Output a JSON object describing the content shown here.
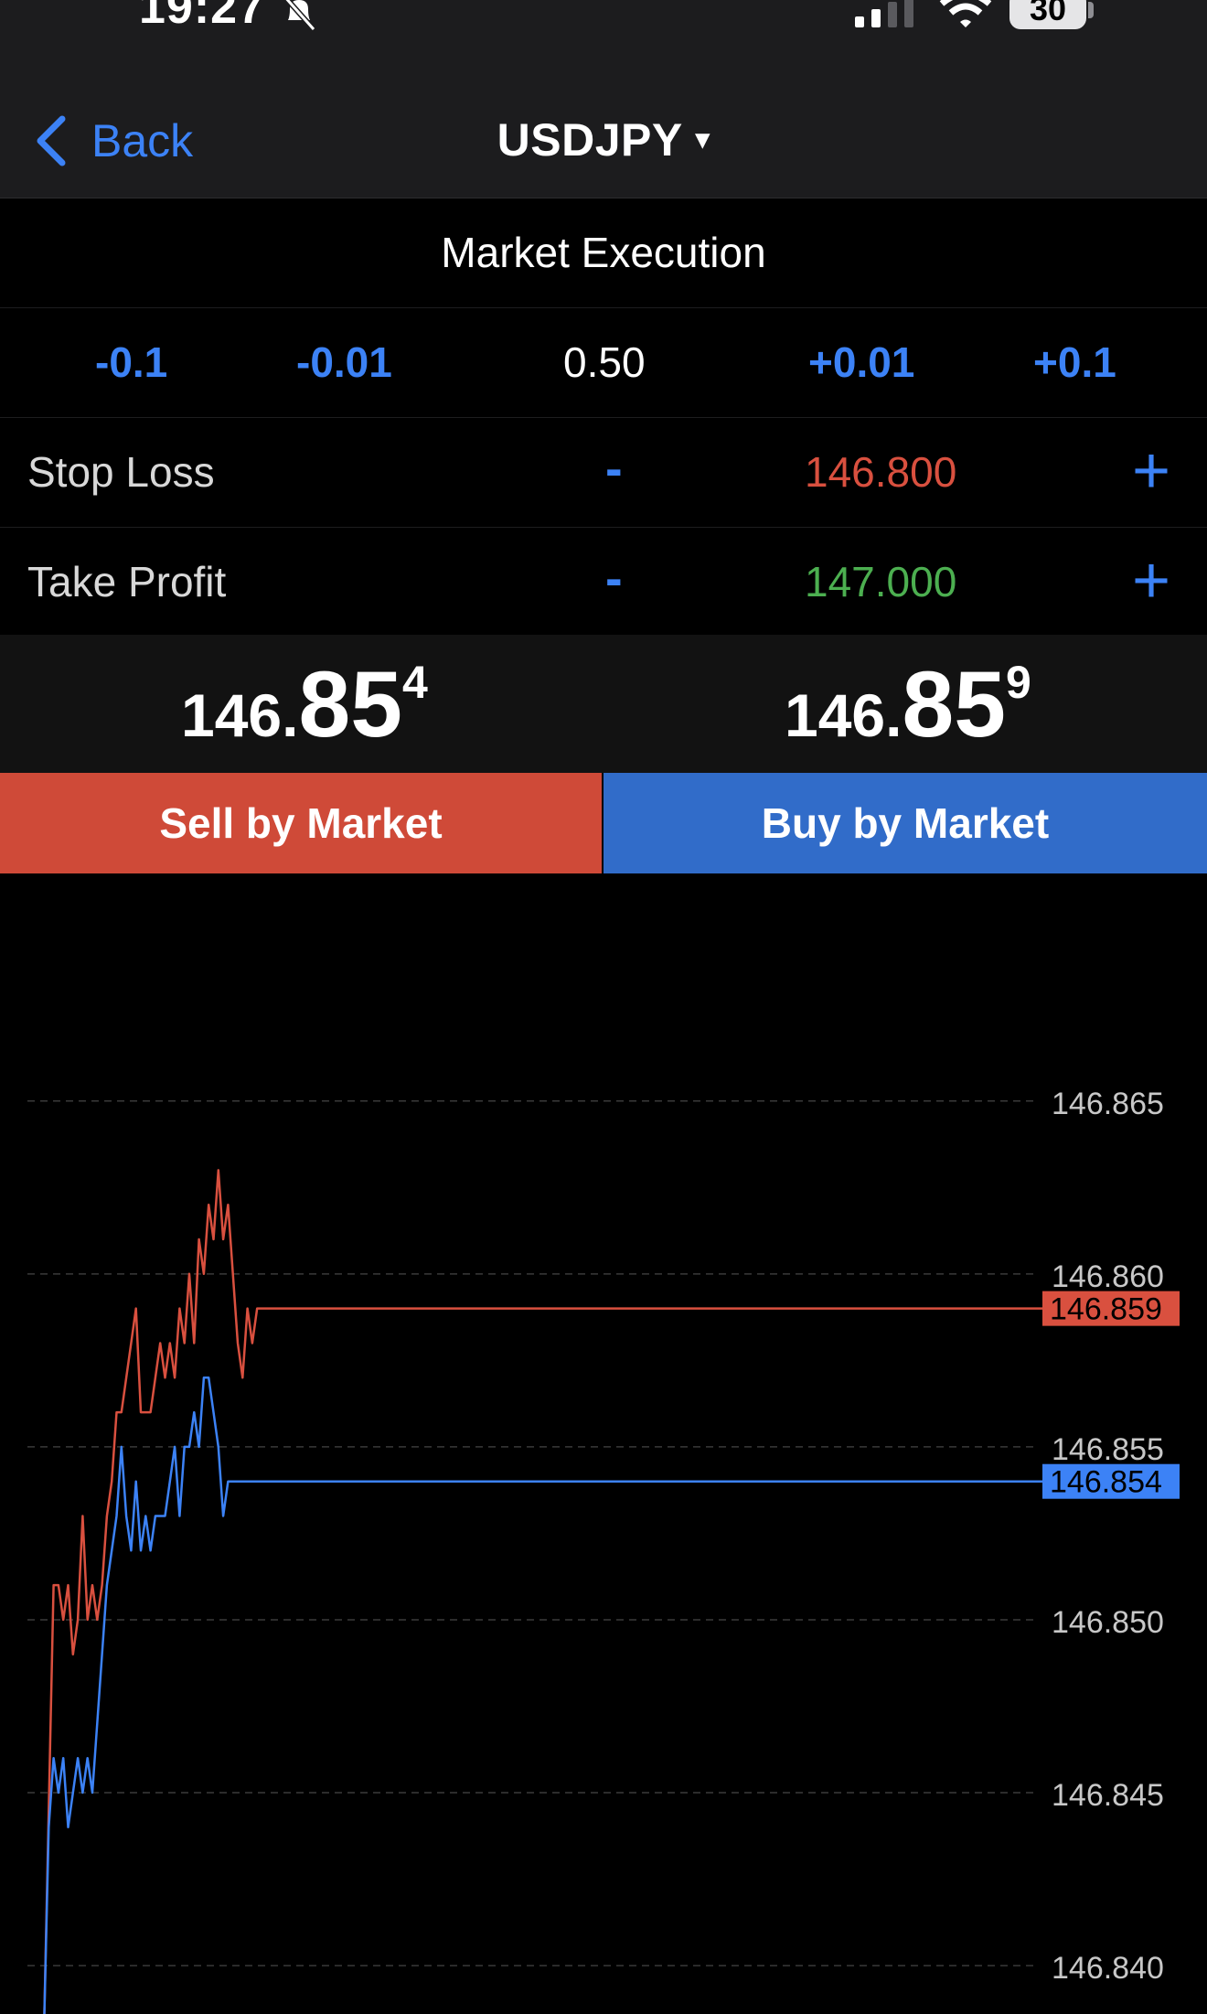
{
  "status_bar": {
    "time": "19:27",
    "battery": "30"
  },
  "nav": {
    "back_label": "Back",
    "symbol": "USDJPY",
    "symbol_caret": "▾"
  },
  "order": {
    "execution_type": "Market Execution",
    "volume_buttons": [
      "-0.1",
      "-0.01",
      "+0.01",
      "+0.1"
    ],
    "volume": "0.50",
    "stop_loss": {
      "label": "Stop Loss",
      "minus": "-",
      "value": "146.800",
      "plus": "+"
    },
    "take_profit": {
      "label": "Take Profit",
      "minus": "-",
      "value": "147.000",
      "plus": "+"
    }
  },
  "prices": {
    "bid": {
      "small": "146.",
      "big": "85",
      "sup": "4"
    },
    "ask": {
      "small": "146.",
      "big": "85",
      "sup": "9"
    }
  },
  "buttons": {
    "sell": "Sell by Market",
    "buy": "Buy by Market"
  },
  "colors": {
    "accent": "#3c82f6",
    "sell": "#cf4a38",
    "buy": "#316cc9",
    "stop_loss": "#d9503f",
    "take_profit": "#4caf50"
  },
  "chart_data": {
    "type": "line",
    "title": "",
    "xlabel": "",
    "ylabel": "",
    "ylim": [
      146.8386,
      146.8715
    ],
    "y_ticks": [
      "146.865",
      "146.860",
      "146.855",
      "146.850",
      "146.845",
      "146.840"
    ],
    "grid": true,
    "series": [
      {
        "role": "ask",
        "color": "#d9503f",
        "current": "146.859",
        "values": [
          146.838,
          146.8445,
          146.851,
          146.851,
          146.85,
          146.851,
          146.849,
          146.85,
          146.853,
          146.85,
          146.851,
          146.85,
          146.851,
          146.853,
          146.854,
          146.856,
          146.856,
          146.857,
          146.858,
          146.859,
          146.856,
          146.856,
          146.856,
          146.857,
          146.858,
          146.857,
          146.858,
          146.857,
          146.859,
          146.858,
          146.86,
          146.858,
          146.861,
          146.86,
          146.862,
          146.861,
          146.863,
          146.861,
          146.862,
          146.86,
          146.858,
          146.857,
          146.859,
          146.858,
          146.859,
          146.859,
          146.859,
          146.859
        ]
      },
      {
        "role": "bid",
        "color": "#3c82f6",
        "current": "146.854",
        "values": [
          146.838,
          146.844,
          146.846,
          146.845,
          146.846,
          146.844,
          146.845,
          146.846,
          146.845,
          146.846,
          146.845,
          146.847,
          146.849,
          146.851,
          146.852,
          146.853,
          146.855,
          146.853,
          146.852,
          146.854,
          146.852,
          146.853,
          146.852,
          146.853,
          146.853,
          146.853,
          146.854,
          146.855,
          146.853,
          146.855,
          146.855,
          146.856,
          146.855,
          146.857,
          146.857,
          146.856,
          146.855,
          146.853,
          146.854,
          146.854,
          146.854,
          146.854
        ]
      }
    ]
  }
}
